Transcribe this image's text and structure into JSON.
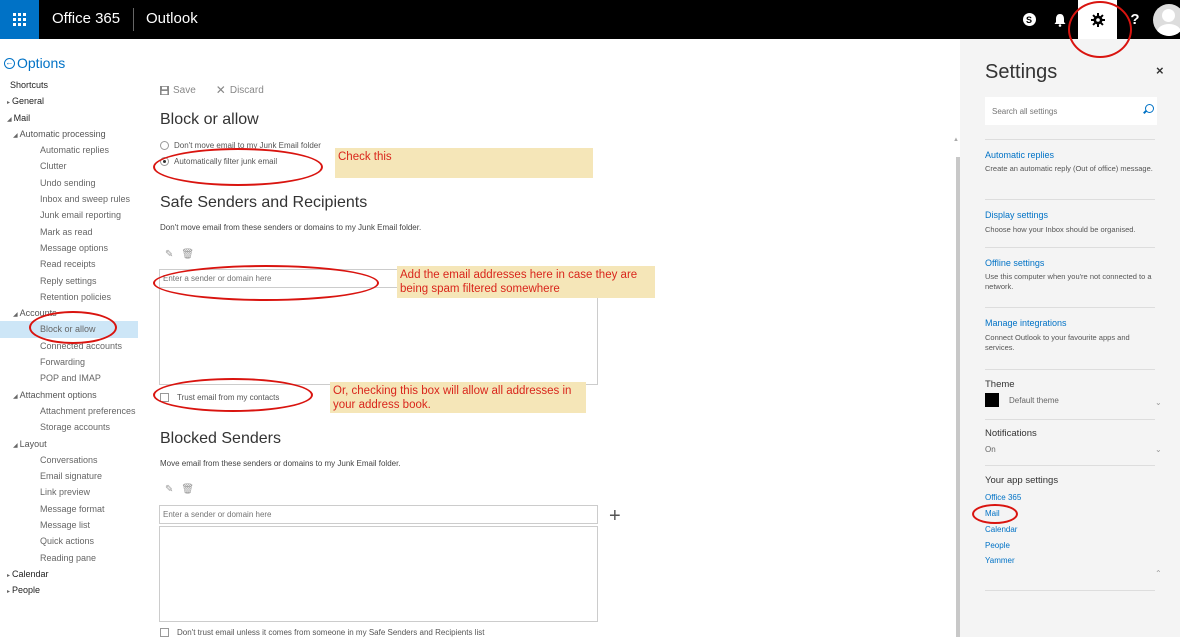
{
  "topbar": {
    "brand": "Office 365",
    "app": "Outlook",
    "skype_glyph": "S",
    "help_glyph": "?"
  },
  "nav": {
    "options_label": "Options",
    "items": [
      {
        "label": "Shortcuts",
        "level": "l1s"
      },
      {
        "label": "General",
        "level": "l1",
        "arrow": "▸"
      },
      {
        "label": "Mail",
        "level": "l1",
        "arrow": "◢"
      },
      {
        "label": "Automatic processing",
        "level": "l2",
        "arrow": "◢"
      },
      {
        "label": "Automatic replies",
        "level": "l3"
      },
      {
        "label": "Clutter",
        "level": "l3"
      },
      {
        "label": "Undo sending",
        "level": "l3"
      },
      {
        "label": "Inbox and sweep rules",
        "level": "l3"
      },
      {
        "label": "Junk email reporting",
        "level": "l3"
      },
      {
        "label": "Mark as read",
        "level": "l3"
      },
      {
        "label": "Message options",
        "level": "l3"
      },
      {
        "label": "Read receipts",
        "level": "l3"
      },
      {
        "label": "Reply settings",
        "level": "l3"
      },
      {
        "label": "Retention policies",
        "level": "l3"
      },
      {
        "label": "Accounts",
        "level": "l2",
        "arrow": "◢"
      },
      {
        "label": "Block or allow",
        "level": "l3",
        "selected": true
      },
      {
        "label": "Connected accounts",
        "level": "l3"
      },
      {
        "label": "Forwarding",
        "level": "l3"
      },
      {
        "label": "POP and IMAP",
        "level": "l3"
      },
      {
        "label": "Attachment options",
        "level": "l2",
        "arrow": "◢"
      },
      {
        "label": "Attachment preferences",
        "level": "l3"
      },
      {
        "label": "Storage accounts",
        "level": "l3"
      },
      {
        "label": "Layout",
        "level": "l2",
        "arrow": "◢"
      },
      {
        "label": "Conversations",
        "level": "l3"
      },
      {
        "label": "Email signature",
        "level": "l3"
      },
      {
        "label": "Link preview",
        "level": "l3"
      },
      {
        "label": "Message format",
        "level": "l3"
      },
      {
        "label": "Message list",
        "level": "l3"
      },
      {
        "label": "Quick actions",
        "level": "l3"
      },
      {
        "label": "Reading pane",
        "level": "l3"
      },
      {
        "label": "Calendar",
        "level": "l1",
        "arrow": "▸"
      },
      {
        "label": "People",
        "level": "l1",
        "arrow": "▸"
      }
    ]
  },
  "main": {
    "toolbar": {
      "save": "Save",
      "discard": "Discard"
    },
    "block_title": "Block or allow",
    "radio_dont_move": "Don't move email to my Junk Email folder",
    "radio_auto_filter": "Automatically filter junk email",
    "safe_title": "Safe Senders and Recipients",
    "safe_desc": "Don't move email from these senders or domains to my Junk Email folder.",
    "safe_placeholder": "Enter a sender or domain here",
    "trust_contacts": "Trust email from my contacts",
    "blocked_title": "Blocked Senders",
    "blocked_desc": "Move email from these senders or domains to my Junk Email folder.",
    "blocked_placeholder": "Enter a sender or domain here",
    "dont_trust": "Don't trust email unless it comes from someone in my Safe Senders and Recipients list",
    "plus_glyph": "+"
  },
  "annotations": {
    "check_this": "Check this",
    "add_emails": "Add the email addresses here in case they are being spam filtered somewhere",
    "or_checking": "Or, checking this box will allow all addresses in your address book."
  },
  "settings": {
    "title": "Settings",
    "close_glyph": "×",
    "search_placeholder": "Search all settings",
    "auto_replies_link": "Automatic replies",
    "auto_replies_desc": "Create an automatic reply (Out of office) message.",
    "display_link": "Display settings",
    "display_desc": "Choose how your Inbox should be organised.",
    "offline_link": "Offline settings",
    "offline_desc": "Use this computer when you're not connected to a network.",
    "integrations_link": "Manage integrations",
    "integrations_desc": "Connect Outlook to your favourite apps and services.",
    "theme_label": "Theme",
    "theme_value": "Default theme",
    "notifications_label": "Notifications",
    "notifications_value": "On",
    "app_settings_label": "Your app settings",
    "app_links": [
      "Office 365",
      "Mail",
      "Calendar",
      "People",
      "Yammer"
    ]
  },
  "colors": {
    "accent": "#0072c6",
    "annotation_red": "#d9140f",
    "annotation_bg": "#f5e6b8",
    "selected_nav": "#cde6f7"
  }
}
